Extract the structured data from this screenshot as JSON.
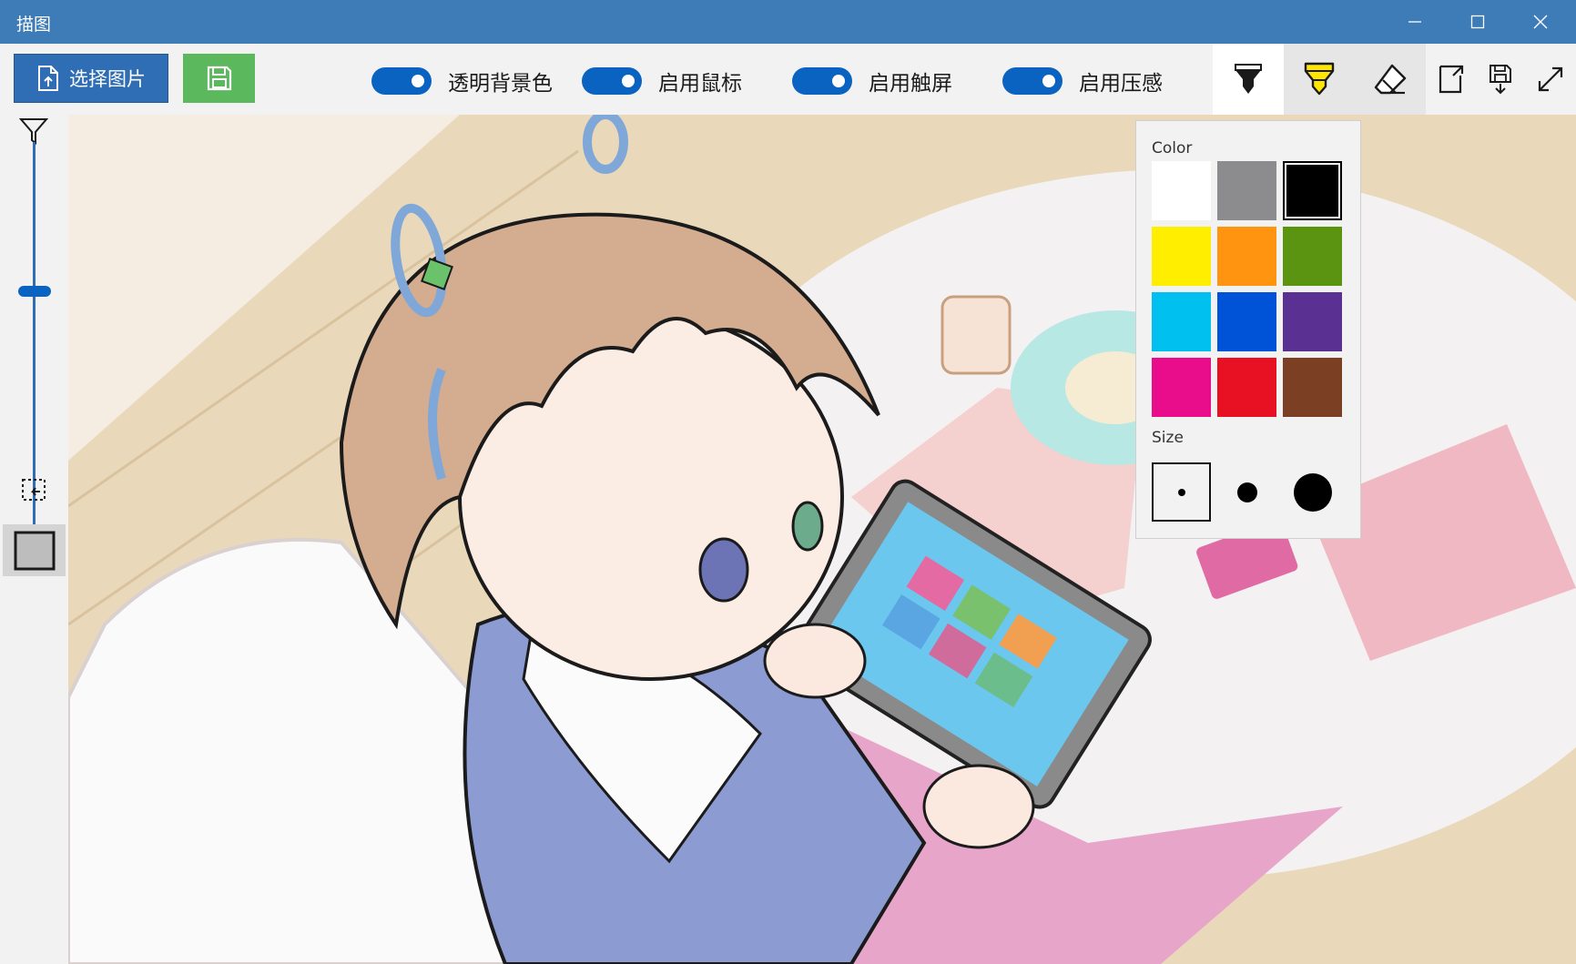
{
  "window": {
    "title": "描图"
  },
  "toolbar": {
    "select_image_label": "选择图片",
    "toggles": [
      {
        "label": "透明背景色",
        "on": true
      },
      {
        "label": "启用鼠标",
        "on": true
      },
      {
        "label": "启用触屏",
        "on": true
      },
      {
        "label": "启用压感",
        "on": true
      }
    ],
    "tools": [
      "pen-icon",
      "highlighter-icon",
      "eraser-icon",
      "export-icon",
      "save-down-icon",
      "fullscreen-icon"
    ],
    "active_tool": "pen"
  },
  "sidebar": {
    "opacity_level": 0.5,
    "icons": [
      "filter-icon",
      "crop-icon",
      "rectangle-icon"
    ]
  },
  "color_panel": {
    "color_label": "Color",
    "size_label": "Size",
    "colors": [
      "#ffffff",
      "#8c8c8e",
      "#000000",
      "#ffee00",
      "#ff9410",
      "#5a9410",
      "#00c0f0",
      "#0052d6",
      "#5a3193",
      "#e90c8b",
      "#e81123",
      "#7b3f24"
    ],
    "selected_color": "#000000",
    "sizes": [
      "small",
      "medium",
      "large"
    ],
    "selected_size": "small"
  },
  "accent_colors": {
    "titlebar": "#3e7cb7",
    "toggle": "#0b63c1",
    "select_button": "#2f6db5",
    "save_button": "#5cb85c"
  }
}
